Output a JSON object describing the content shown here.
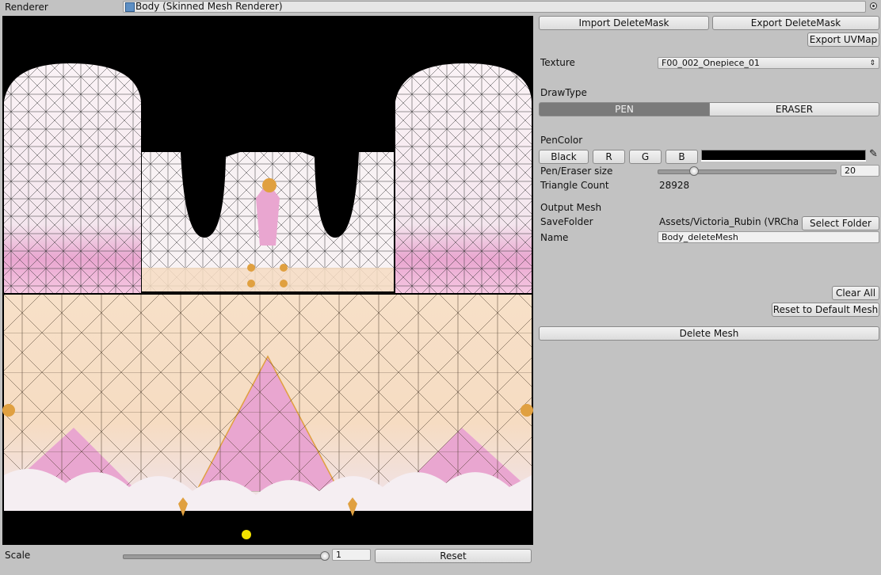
{
  "renderer": {
    "label": "Renderer",
    "value": "Body (Skinned Mesh Renderer)",
    "target_icon": "target-icon"
  },
  "toolbar": {
    "import_label": "Import DeleteMask",
    "export_label": "Export DeleteMask",
    "export_uv_label": "Export UVMap"
  },
  "texture": {
    "label": "Texture",
    "value": "F00_002_Onepiece_01"
  },
  "draw_type": {
    "label": "DrawType",
    "options": [
      "PEN",
      "ERASER"
    ],
    "selected": "PEN"
  },
  "pen_color": {
    "label": "PenColor",
    "buttons": [
      "Black",
      "R",
      "G",
      "B"
    ],
    "swatch_color": "#000000",
    "picker_icon": "eyedropper-icon"
  },
  "pen_size": {
    "label": "Pen/Eraser size",
    "value": "20",
    "fraction": 0.19
  },
  "triangle_count": {
    "label": "Triangle Count",
    "value": "28928"
  },
  "output_mesh": {
    "section_label": "Output Mesh",
    "save_folder_label": "SaveFolder",
    "save_folder_value": "Assets/Victoria_Rubin (VRCha",
    "select_folder_label": "Select Folder",
    "name_label": "Name",
    "name_value": "Body_deleteMesh"
  },
  "actions": {
    "clear_all": "Clear All",
    "reset_default": "Reset to Default Mesh",
    "delete_mesh": "Delete Mesh"
  },
  "scale": {
    "label": "Scale",
    "value": "1",
    "fraction": 0.99,
    "reset_label": "Reset"
  },
  "colors": {
    "panel_bg": "#c2c2c2",
    "preview_bg": "#000000",
    "pen_selected": "#7a7a7a",
    "cursor_dot": "#f2e200"
  }
}
